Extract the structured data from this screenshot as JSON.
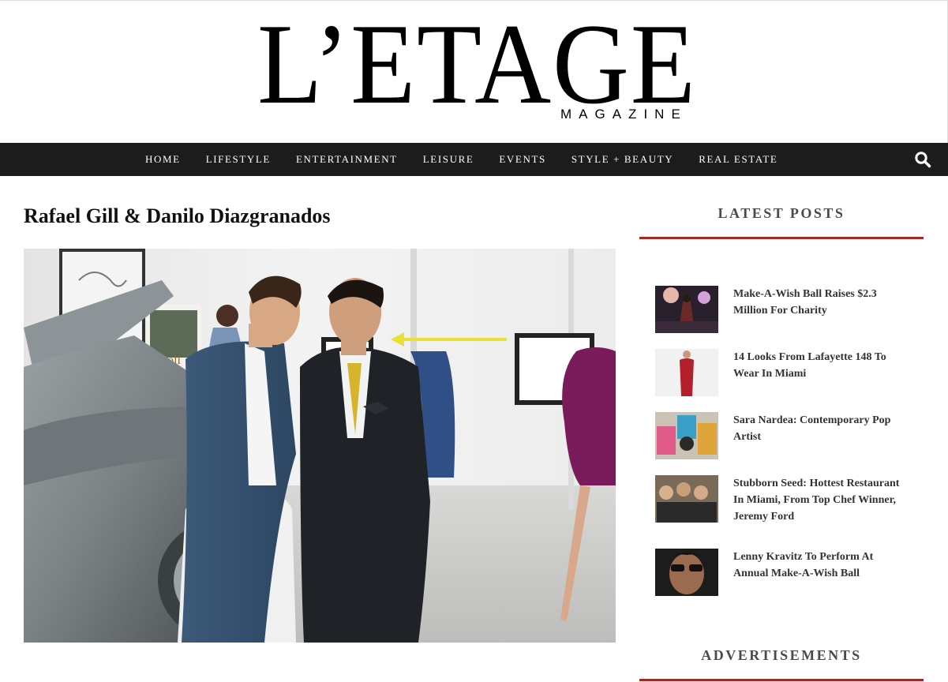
{
  "logo": {
    "main": "L’ETAGE",
    "sub": "MAGAZINE"
  },
  "nav": {
    "items": [
      "HOME",
      "LIFESTYLE",
      "ENTERTAINMENT",
      "LEISURE",
      "EVENTS",
      "STYLE + BEAUTY",
      "REAL ESTATE"
    ],
    "search_icon": "search-icon"
  },
  "article": {
    "title": "Rafael Gill & Danilo Diazgranados",
    "photo_sign": "bāoli"
  },
  "sidebar": {
    "latest_title": "LATEST POSTS",
    "posts": [
      {
        "title": "Make-A-Wish Ball Raises $2.3 Million For Charity"
      },
      {
        "title": "14 Looks From Lafayette 148 To Wear In Miami"
      },
      {
        "title": "Sara Nardea: Contemporary Pop Artist"
      },
      {
        "title": "Stubborn Seed: Hottest Restaurant In Miami, From Top Chef Winner, Jeremy Ford"
      },
      {
        "title": "Lenny Kravitz To Perform At Annual Make-A-Wish Ball"
      }
    ],
    "ads_title": "ADVERTISEMENTS"
  },
  "colors": {
    "nav_bg": "#1c1c1c",
    "accent_bar": "#a32a22",
    "title_text": "#111111"
  }
}
